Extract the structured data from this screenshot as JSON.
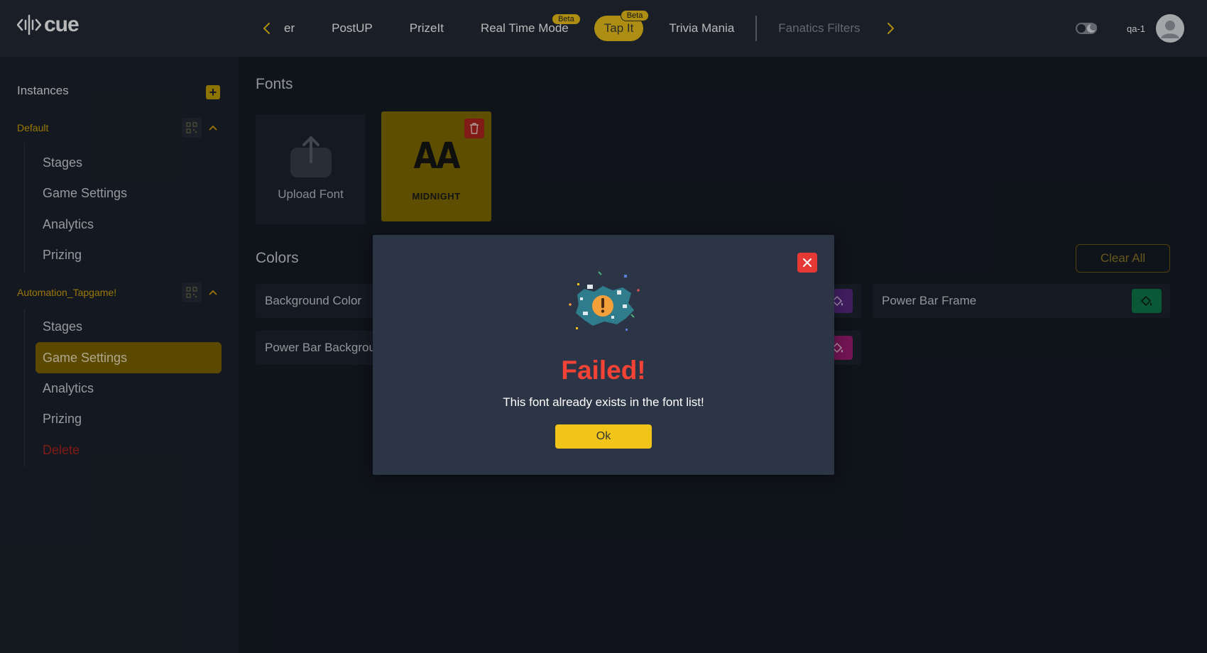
{
  "app": {
    "logo_text": "cue"
  },
  "topnav": {
    "tabs": [
      {
        "label": "er",
        "badge": ""
      },
      {
        "label": "PostUP",
        "badge": ""
      },
      {
        "label": "PrizeIt",
        "badge": ""
      },
      {
        "label": "Real Time Mode",
        "badge": "Beta"
      },
      {
        "label": "Tap It",
        "badge": "Beta"
      },
      {
        "label": "Trivia Mania",
        "badge": ""
      },
      {
        "label": "Fanatics Filters",
        "badge": ""
      }
    ],
    "user": "qa-1"
  },
  "sidebar": {
    "title": "Instances",
    "groups": [
      {
        "name": "Default",
        "items": [
          "Stages",
          "Game Settings",
          "Analytics",
          "Prizing"
        ]
      },
      {
        "name": "Automation_Tapgame!",
        "items": [
          "Stages",
          "Game Settings",
          "Analytics",
          "Prizing",
          "Delete"
        ]
      }
    ]
  },
  "main": {
    "fonts_title": "Fonts",
    "upload_label": "Upload Font",
    "font_card": {
      "preview": "AA",
      "name": "MIDNIGHT"
    },
    "colors_title": "Colors",
    "clear_all": "Clear All",
    "colors": [
      {
        "label": "Background Color",
        "swatch": "#5b2a86"
      },
      {
        "label": "Power Bar Frame",
        "swatch": "#0f7a4a"
      },
      {
        "label": "Power Bar Background",
        "swatch": "#a01c74"
      }
    ]
  },
  "modal": {
    "title": "Failed!",
    "message": "This font already exists in the font list!",
    "ok_label": "Ok"
  },
  "colors": {
    "accent": "#f0c419",
    "error": "#f44336",
    "sidebar_active": "#806600"
  },
  "icons": [
    "back-chevron-icon",
    "forward-chevron-icon",
    "theme-toggle-icon",
    "user-icon",
    "plus-icon",
    "qr-code-icon",
    "chevron-up-icon",
    "upload-icon",
    "trash-icon",
    "paint-bucket-icon",
    "close-icon",
    "warning-illustration"
  ]
}
